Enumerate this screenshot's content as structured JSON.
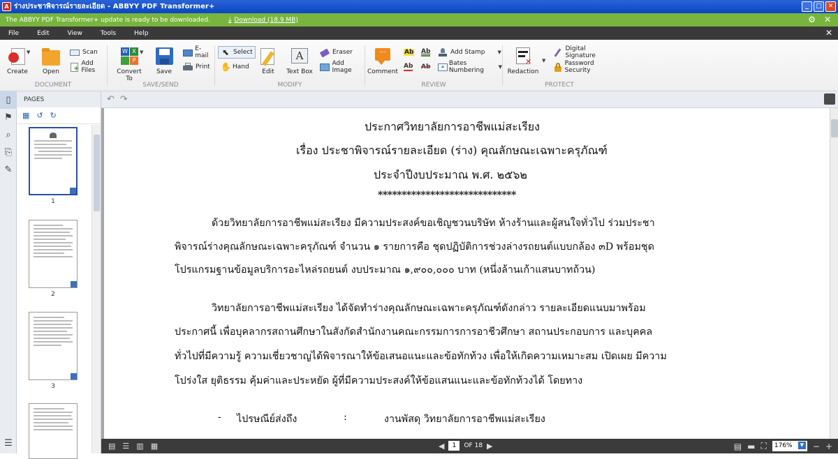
{
  "window": {
    "title": "ร่างประชาพิจารณ์รายละเอียด - ABBYY PDF Transformer+",
    "minimize": "_",
    "maximize": "□",
    "close": "✕"
  },
  "update_bar": {
    "message": "The ABBYY PDF Transformer+ update is ready to be downloaded.",
    "download_link": "Download (18.9 MB)"
  },
  "menu": [
    "File",
    "Edit",
    "View",
    "Tools",
    "Help"
  ],
  "ribbon": {
    "groups": {
      "document": "DOCUMENT",
      "save_send": "SAVE/SEND",
      "modify": "MODIFY",
      "review": "REVIEW",
      "protect": "PROTECT"
    },
    "create": "Create",
    "open": "Open",
    "scan": "Scan",
    "add_files": "Add Files",
    "convert_to": "Convert To",
    "save": "Save",
    "email": "E-mail",
    "print": "Print",
    "select": "Select",
    "hand": "Hand",
    "edit": "Edit",
    "text_box": "Text Box",
    "eraser": "Eraser",
    "add_image": "Add Image",
    "comment": "Comment",
    "add_stamp": "Add Stamp",
    "bates_numbering": "Bates Numbering",
    "redaction": "Redaction",
    "digital_signature": "Digital Signature",
    "password_security": "Password Security",
    "highlight_a": "Ab",
    "underline_a": "Ab",
    "highlight_b": "Ab",
    "strikethrough_b": "Ab"
  },
  "pages_panel": {
    "header": "PAGES",
    "thumb_labels": [
      "1",
      "2",
      "3"
    ]
  },
  "document": {
    "lines": [
      "ประกาศวิทยาลัยการอาชีพแม่สะเรียง",
      "เรื่อง  ประชาพิจารณ์รายละเอียด (ร่าง) คุณลักษณะเฉพาะครุภัณฑ์",
      "ประจำปีงบประมาณ พ.ศ. ๒๕๖๒",
      "*****************************",
      "ด้วยวิทยาลัยการอาชีพแม่สะเรียง มีความประสงค์ขอเชิญชวนบริษัท ห้างร้านและผู้สนใจทั่วไป ร่วมประชา",
      "พิจารณ์ร่างคุณลักษณะเฉพาะครุภัณฑ์ จำนวน ๑ รายการคือ ชุดปฏิบัติการช่วงล่างรถยนต์แบบกล้อง ๓D พร้อมชุด",
      "โปรแกรมฐานข้อมูลบริการอะไหล่รถยนต์ งบประมาณ ๑,๙๐๐,๐๐๐ บาท (หนึ่งล้านเก้าแสนบาทถ้วน)",
      "วิทยาลัยการอาชีพแม่สะเรียง ได้จัดทำร่างคุณลักษณะเฉพาะครุภัณฑ์ดังกล่าว รายละเอียดแนบมาพร้อม",
      "ประกาศนี้ เพื่อบุคลากรสถานศึกษาในสังกัดสำนักงานคณะกรรมการการอาชีวศึกษา สถานประกอบการ และบุคคล",
      "ทั่วไปที่มีความรู้ ความเชี่ยวชาญได้พิจารณาให้ข้อเสนอแนะและข้อทักท้วง เพื่อให้เกิดความเหมาะสม เปิดเผย มีความ",
      "โปร่งใส ยุติธรรม คุ้มค่าและประหยัด ผู้ที่มีความประสงค์ให้ข้อแสนแนะและข้อทักท้วงได้ โดยทาง"
    ],
    "item_dash": "-",
    "item_label": "ไปรษณีย์ส่งถึง",
    "item_colon": ":",
    "item_value": "งานพัสดุ วิทยาลัยการอาชีพแม่สะเรียง"
  },
  "status": {
    "page_current": "1",
    "page_total": "OF 18",
    "zoom": "176%"
  }
}
